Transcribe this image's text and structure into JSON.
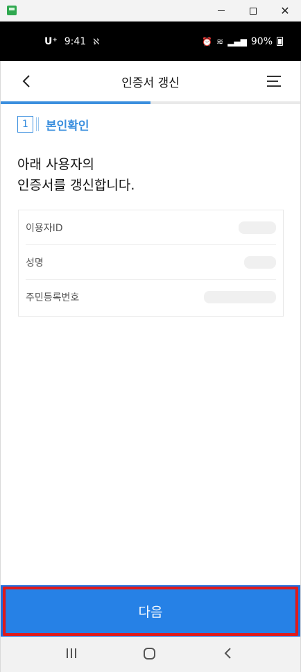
{
  "window": {
    "minimize_icon": "minimize-icon",
    "maximize_icon": "maximize-icon",
    "close_glyph": "✕"
  },
  "status_bar": {
    "carrier": "U⁺",
    "time": "9:41",
    "battery": "90%"
  },
  "header": {
    "title": "인증서 갱신",
    "back_icon": "chevron-left-icon",
    "menu_icon": "hamburger-menu-icon"
  },
  "progress": {
    "fraction": 0.5
  },
  "step": {
    "number": "1",
    "label": "본인확인"
  },
  "intro": {
    "line1": "아래 사용자의",
    "line2": "인증서를 갱신합니다."
  },
  "info": {
    "rows": [
      {
        "label": "이용자ID"
      },
      {
        "label": "성명"
      },
      {
        "label": "주민등록번호"
      }
    ]
  },
  "next_button": {
    "label": "다음"
  },
  "colors": {
    "accent": "#3b8fde",
    "button": "#2681e6",
    "highlight": "#e01a1a"
  }
}
